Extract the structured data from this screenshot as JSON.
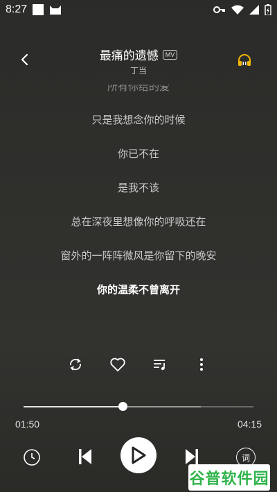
{
  "status_bar": {
    "time": "8:27"
  },
  "header": {
    "title": "最痛的遗憾",
    "mv_badge": "MV",
    "artist": "丁当"
  },
  "lyrics": [
    {
      "text": "所有你给的爱",
      "state": "faded"
    },
    {
      "text": "只是我想念你的时候",
      "state": "normal"
    },
    {
      "text": "你已不在",
      "state": "normal"
    },
    {
      "text": "是我不该",
      "state": "normal"
    },
    {
      "text": "总在深夜里想像你的呼吸还在",
      "state": "normal"
    },
    {
      "text": "窗外的一阵阵微风是你留下的晚安",
      "state": "normal"
    },
    {
      "text": "你的温柔不曾离开",
      "state": "current"
    }
  ],
  "playback": {
    "current_time": "01:50",
    "total_time": "04:15",
    "progress_fraction": 0.43,
    "buffered_fraction": 0.77
  },
  "icons": {
    "back": "chevron-left-icon",
    "headphone": "headphone-icon",
    "repeat": "repeat-icon",
    "like": "heart-icon",
    "playlist": "playlist-icon",
    "more": "more-vertical-icon",
    "timer": "clock-icon",
    "prev": "skip-previous-icon",
    "play": "play-icon",
    "next": "skip-next-icon",
    "lyric": "lyric-icon"
  },
  "colors": {
    "accent_headphone": "#f5b800",
    "watermark_green": "#2fb34a"
  },
  "lyric_toggle_label": "词",
  "watermark": "谷普软件园"
}
